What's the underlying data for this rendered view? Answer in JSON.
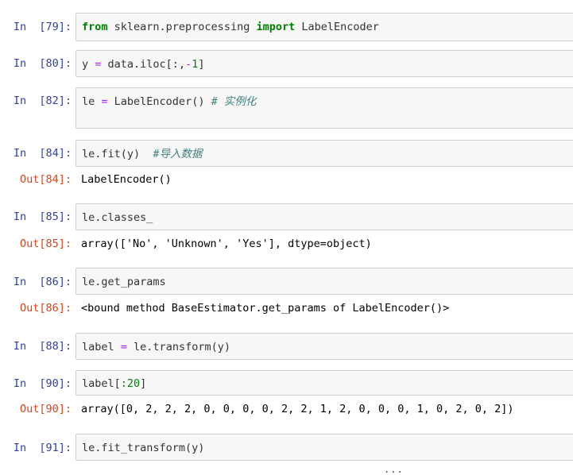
{
  "cells": [
    {
      "in_prompt": "In  [79]:",
      "code": {
        "kw1": "from",
        "mod": " sklearn.preprocessing ",
        "kw2": "import",
        "name": " LabelEncoder"
      }
    },
    {
      "in_prompt": "In  [80]:",
      "code": {
        "a": "y ",
        "eq": "=",
        "b": " data.iloc[:,",
        "minus": "-",
        "one": "1",
        "c": "]"
      }
    },
    {
      "in_prompt": "In  [82]:",
      "code": {
        "a": "le ",
        "eq": "=",
        "b": " LabelEncoder() ",
        "comment": "# 实例化"
      }
    },
    {
      "in_prompt": "In  [84]:",
      "code": {
        "a": "le.fit(y)  ",
        "comment": "#导入数据"
      },
      "out_prompt": "Out[84]:",
      "output": "LabelEncoder()"
    },
    {
      "in_prompt": "In  [85]:",
      "code": {
        "a": "le.classes_"
      },
      "out_prompt": "Out[85]:",
      "output": "array(['No', 'Unknown', 'Yes'], dtype=object)"
    },
    {
      "in_prompt": "In  [86]:",
      "code": {
        "a": "le.get_params"
      },
      "out_prompt": "Out[86]:",
      "output": "<bound method BaseEstimator.get_params of LabelEncoder()>"
    },
    {
      "in_prompt": "In  [88]:",
      "code": {
        "a": "label ",
        "eq": "=",
        "b": " le.transform(y)"
      }
    },
    {
      "in_prompt": "In  [90]:",
      "code": {
        "a": "label[",
        "slice": ":20",
        "c": "]"
      },
      "out_prompt": "Out[90]:",
      "output": "array([0, 2, 2, 2, 0, 0, 0, 0, 2, 2, 1, 2, 0, 0, 0, 1, 0, 2, 0, 2])"
    },
    {
      "in_prompt": "In  [91]:",
      "code": {
        "a": "le.fit_transform(y)"
      }
    }
  ],
  "more_indicator": "..."
}
